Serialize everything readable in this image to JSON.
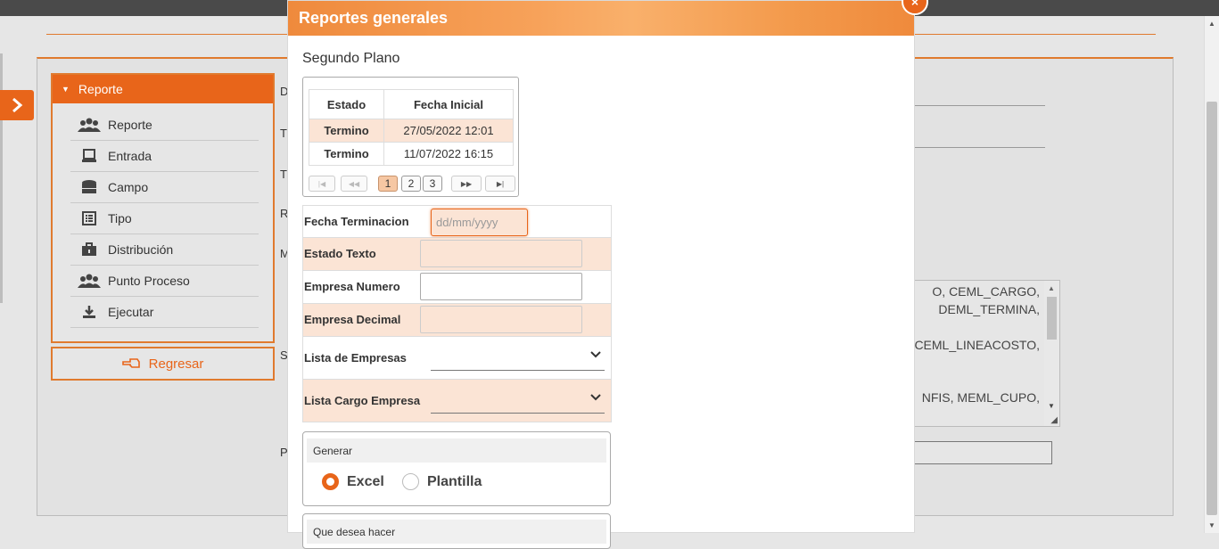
{
  "modal": {
    "title": "Reportes generales",
    "subtitle": "Segundo Plano",
    "close_icon": "×",
    "grid": {
      "headers": [
        "Estado",
        "Fecha Inicial"
      ],
      "rows": [
        {
          "estado": "Termino",
          "fecha": "27/05/2022 12:01"
        },
        {
          "estado": "Termino",
          "fecha": "11/07/2022 16:15"
        }
      ],
      "pager": {
        "first": "|◀",
        "prev": "◀◀",
        "pages": [
          "1",
          "2",
          "3"
        ],
        "active_page": "1",
        "next": "▶▶",
        "last": "▶|"
      }
    },
    "form": {
      "fecha_terminacion": {
        "label": "Fecha Terminacion",
        "placeholder": "dd/mm/yyyy"
      },
      "estado_texto": {
        "label": "Estado Texto",
        "value": ""
      },
      "empresa_numero": {
        "label": "Empresa Numero",
        "value": ""
      },
      "empresa_decimal": {
        "label": "Empresa Decimal",
        "value": ""
      },
      "lista_empresas": {
        "label": "Lista de Empresas",
        "value": ""
      },
      "lista_cargo_empresa": {
        "label": "Lista Cargo Empresa",
        "value": ""
      }
    },
    "generar": {
      "heading": "Generar",
      "options": [
        "Excel",
        "Plantilla"
      ],
      "selected": "Excel"
    },
    "next_section": {
      "heading": "Que desea hacer"
    }
  },
  "sidebar": {
    "header": "Reporte",
    "items": [
      {
        "label": "Reporte",
        "icon": "users-icon"
      },
      {
        "label": "Entrada",
        "icon": "laptop-icon"
      },
      {
        "label": "Campo",
        "icon": "database-icon"
      },
      {
        "label": "Tipo",
        "icon": "list-icon"
      },
      {
        "label": "Distribución",
        "icon": "briefcase-icon"
      },
      {
        "label": "Punto Proceso",
        "icon": "users-icon"
      },
      {
        "label": "Ejecutar",
        "icon": "download-icon"
      }
    ],
    "back_button": "Regresar"
  },
  "background": {
    "row_letters": [
      "D",
      "T",
      "T",
      "R",
      "M",
      "S",
      "P"
    ],
    "textarea_lines": [
      "O, CEML_CARGO,",
      "DEML_TERMINA,",
      "CEML_LINEACOSTO,",
      "NFIS,    MEML_CUPO,"
    ]
  },
  "colors": {
    "accent": "#e8651a",
    "highlight": "#fbe4d5",
    "header_gradient": "#f7a25a"
  }
}
